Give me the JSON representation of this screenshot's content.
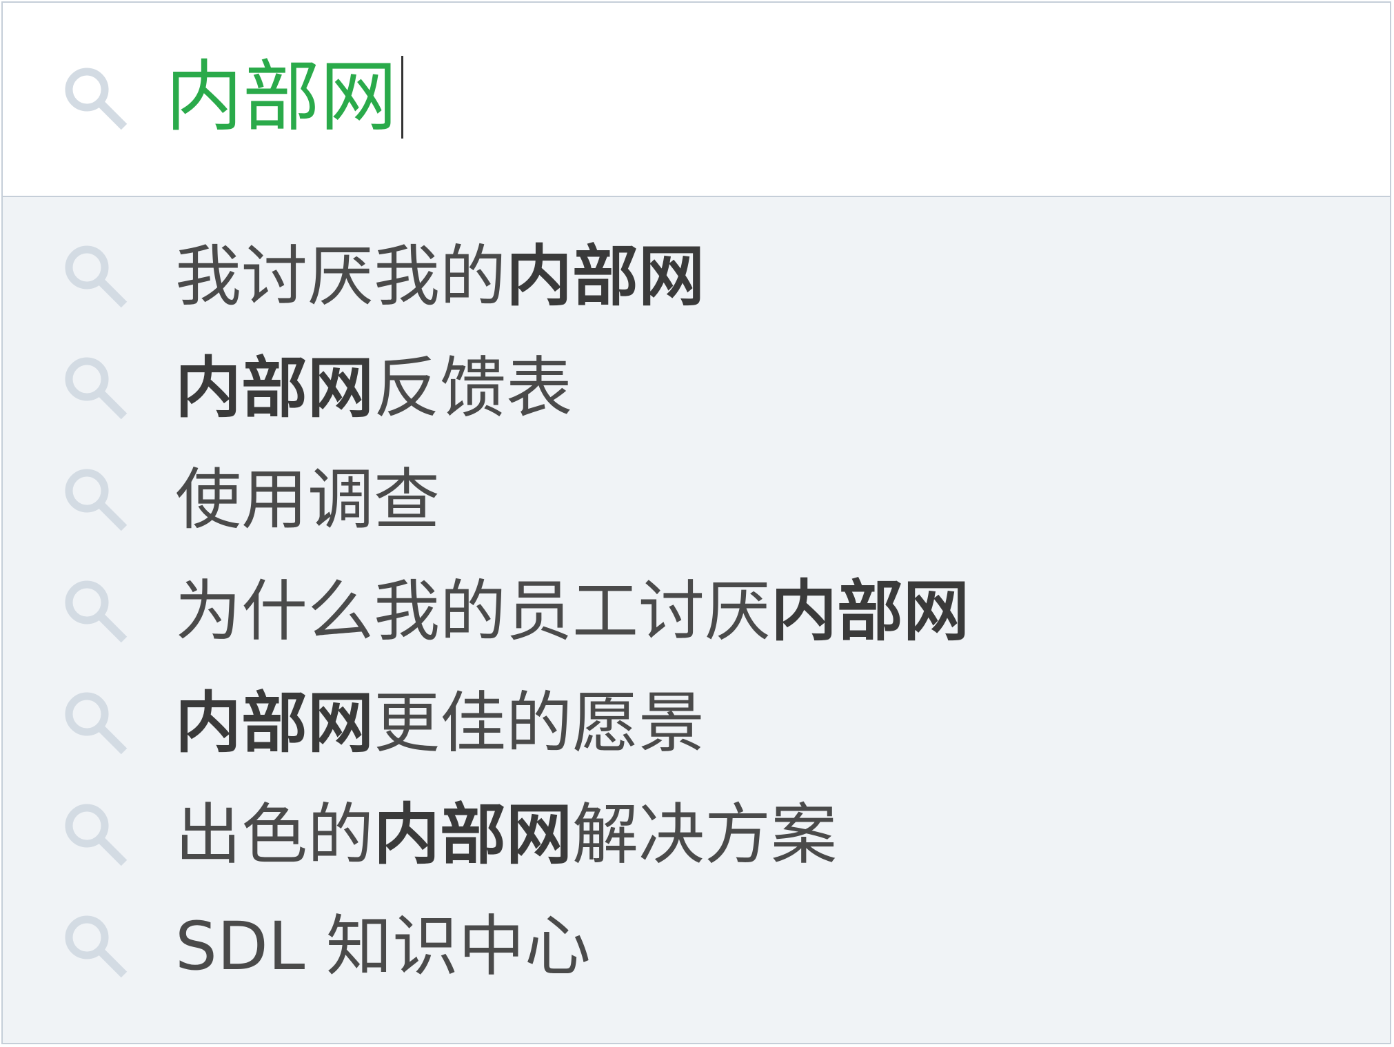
{
  "search": {
    "query": "内部网",
    "icon": "search-icon",
    "query_color": "#2aaa4a"
  },
  "suggestions": [
    {
      "parts": [
        {
          "text": "我讨厌我的",
          "bold": false
        },
        {
          "text": "内部网",
          "bold": true
        }
      ]
    },
    {
      "parts": [
        {
          "text": "内部网",
          "bold": true
        },
        {
          "text": "反馈表",
          "bold": false
        }
      ]
    },
    {
      "parts": [
        {
          "text": "使用调查",
          "bold": false
        }
      ]
    },
    {
      "parts": [
        {
          "text": "为什么我的员工讨厌",
          "bold": false
        },
        {
          "text": "内部网",
          "bold": true
        }
      ]
    },
    {
      "parts": [
        {
          "text": "内部网",
          "bold": true
        },
        {
          "text": "更佳的愿景",
          "bold": false
        }
      ]
    },
    {
      "parts": [
        {
          "text": "出色的",
          "bold": false
        },
        {
          "text": "内部网",
          "bold": true
        },
        {
          "text": "解决方案",
          "bold": false
        }
      ]
    },
    {
      "parts": [
        {
          "text": "SDL 知识中心",
          "bold": false
        }
      ]
    }
  ],
  "colors": {
    "border": "#c5ced8",
    "dropdown_bg": "#f0f3f6",
    "icon": "#d3dbe3",
    "text": "#4a4a4a"
  }
}
